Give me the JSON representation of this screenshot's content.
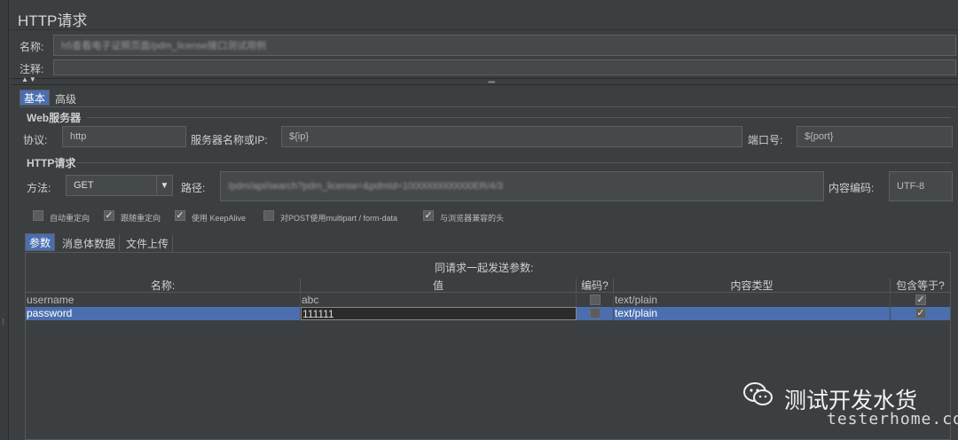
{
  "window": {
    "title": "HTTP请求"
  },
  "name": {
    "label": "名称:",
    "value": "h5查看电子证照页面/pdm_license接口测试用例"
  },
  "comment": {
    "label": "注释:",
    "value": ""
  },
  "main_tabs": [
    {
      "label": "基本"
    },
    {
      "label": "高级"
    }
  ],
  "web_server": {
    "group_title": "Web服务器",
    "protocol_label": "协议:",
    "protocol_value": "http",
    "server_label": "服务器名称或IP:",
    "server_value": "${ip}",
    "port_label": "端口号:",
    "port_value": "${port}"
  },
  "http_request": {
    "group_title": "HTTP请求",
    "method_label": "方法:",
    "method_value": "GET",
    "path_label": "路径:",
    "path_value": "/pdm/api/search?pdm_license=&pdmId=1000000000000ER/4/3",
    "encoding_label": "内容编码:",
    "encoding_value": "UTF-8"
  },
  "options": [
    {
      "label": "自动重定向",
      "checked": false
    },
    {
      "label": "跟随重定向",
      "checked": true
    },
    {
      "label": "使用 KeepAlive",
      "checked": true
    },
    {
      "label": "对POST使用multipart / form-data",
      "checked": false
    },
    {
      "label": "与浏览器兼容的头",
      "checked": true
    }
  ],
  "sub_tabs": [
    {
      "label": "参数"
    },
    {
      "label": "消息体数据"
    },
    {
      "label": "文件上传"
    }
  ],
  "params": {
    "caption": "同请求一起发送参数:",
    "columns": [
      "名称:",
      "值",
      "编码?",
      "内容类型",
      "包含等于?"
    ],
    "rows": [
      {
        "name": "username",
        "value": "abc",
        "encode": false,
        "content_type": "text/plain",
        "include_equals": true
      },
      {
        "name": "password",
        "value": "111111",
        "encode": false,
        "content_type": "text/plain",
        "include_equals": true
      }
    ]
  },
  "watermark": {
    "title": "测试开发水货",
    "subtitle": "testerhome.com"
  },
  "colors": {
    "background": "#3c3f41",
    "field": "#45494a",
    "selection": "#4b6eaf"
  }
}
